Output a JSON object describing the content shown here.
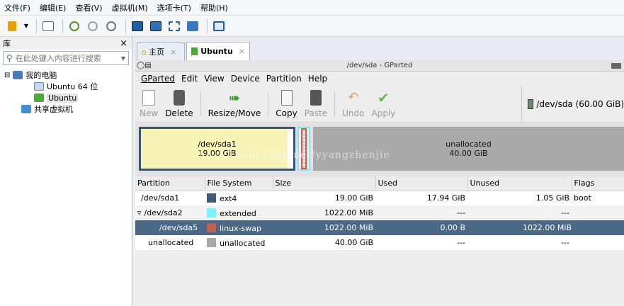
{
  "vmware": {
    "menu": [
      "文件(F)",
      "编辑(E)",
      "查看(V)",
      "虚拟机(M)",
      "选项卡(T)",
      "帮助(H)"
    ],
    "library": {
      "title": "库",
      "close": "×",
      "search_placeholder": "在此处键入内容进行搜索",
      "tree": [
        {
          "label": "我的电脑",
          "indent": 0,
          "expander": "⊟"
        },
        {
          "label": "Ubuntu 64 位",
          "indent": 1
        },
        {
          "label": "Ubuntu",
          "indent": 1,
          "selected": true
        },
        {
          "label": "共享虚拟机",
          "indent": 0
        }
      ]
    },
    "tabs": [
      {
        "label": "主页",
        "close": "×"
      },
      {
        "label": "Ubuntu",
        "close": "×",
        "active": true
      }
    ]
  },
  "gparted": {
    "window_title": "/dev/sda - GParted",
    "menu": [
      "GParted",
      "Edit",
      "View",
      "Device",
      "Partition",
      "Help"
    ],
    "toolbar": [
      {
        "label": "New",
        "disabled": true
      },
      {
        "label": "Delete",
        "disabled": false
      },
      {
        "label": "Resize/Move",
        "disabled": false
      },
      {
        "label": "Copy",
        "disabled": false
      },
      {
        "label": "Paste",
        "disabled": true
      },
      {
        "label": "Undo",
        "disabled": true
      },
      {
        "label": "Apply",
        "disabled": true
      }
    ],
    "device_label": "/dev/sda  (60.00 GiB)",
    "map": {
      "part1_name": "/dev/sda1",
      "part1_size": "19.00 GiB",
      "unalloc_name": "unallocated",
      "unalloc_size": "40.00 GiB",
      "watermark": "http://blog.csdn.net/yyangzhenjie"
    },
    "columns": [
      "Partition",
      "File System",
      "Size",
      "Used",
      "Unused",
      "Flags"
    ],
    "rows": [
      {
        "partition": "/dev/sda1",
        "fs": "ext4",
        "fs_color": "#3e5a78",
        "size": "19.00 GiB",
        "used": "17.94 GiB",
        "unused": "1.05 GiB",
        "flags": "boot"
      },
      {
        "partition": "/dev/sda2",
        "fs": "extended",
        "fs_color": "#7ff0ff",
        "size": "1022.00 MiB",
        "used": "---",
        "unused": "---",
        "flags": "",
        "expander": "▿"
      },
      {
        "partition": "/dev/sda5",
        "fs": "linux-swap",
        "fs_color": "#c0604e",
        "size": "1022.00 MiB",
        "used": "0.00 B",
        "unused": "1022.00 MiB",
        "flags": "",
        "selected": true
      },
      {
        "partition": "unallocated",
        "fs": "unallocated",
        "fs_color": "#a8a8a8",
        "size": "40.00 GiB",
        "used": "---",
        "unused": "---",
        "flags": ""
      }
    ]
  }
}
